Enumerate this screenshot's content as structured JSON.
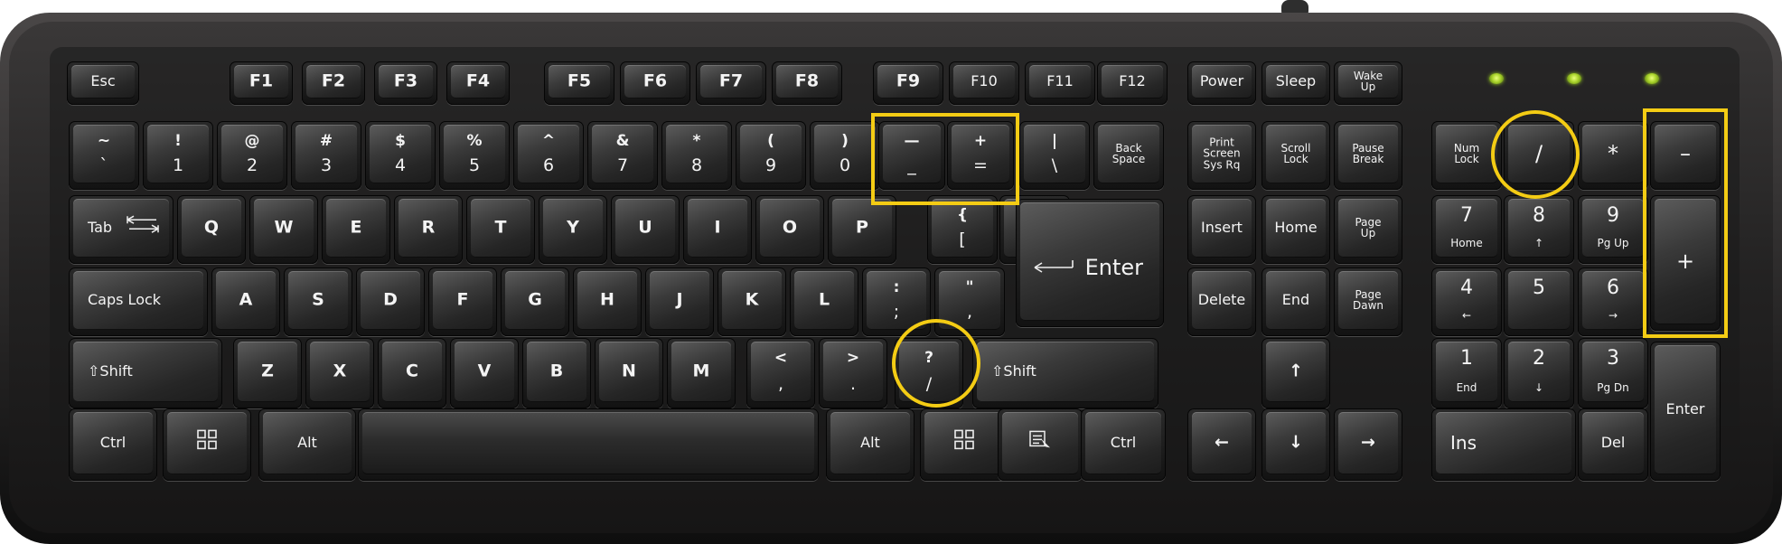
{
  "colors": {
    "body": "#1c1c1c",
    "highlight": "#f4cc14",
    "led": "#a8d22a",
    "legend": "#f4f4f4"
  },
  "indicator_leds": 3,
  "keys": [
    {
      "id": "esc",
      "name": "esc-key",
      "label": "Esc"
    },
    {
      "id": "f1",
      "name": "f1-key",
      "label": "F1"
    },
    {
      "id": "f2",
      "name": "f2-key",
      "label": "F2"
    },
    {
      "id": "f3",
      "name": "f3-key",
      "label": "F3"
    },
    {
      "id": "f4",
      "name": "f4-key",
      "label": "F4"
    },
    {
      "id": "f5",
      "name": "f5-key",
      "label": "F5"
    },
    {
      "id": "f6",
      "name": "f6-key",
      "label": "F6"
    },
    {
      "id": "f7",
      "name": "f7-key",
      "label": "F7"
    },
    {
      "id": "f8",
      "name": "f8-key",
      "label": "F8"
    },
    {
      "id": "f9",
      "name": "f9-key",
      "label": "F9"
    },
    {
      "id": "f10",
      "name": "f10-key",
      "label": "F10"
    },
    {
      "id": "f11",
      "name": "f11-key",
      "label": "F11"
    },
    {
      "id": "f12",
      "name": "f12-key",
      "label": "F12"
    },
    {
      "id": "power",
      "name": "power-key",
      "label": "Power"
    },
    {
      "id": "sleep",
      "name": "sleep-key",
      "label": "Sleep"
    },
    {
      "id": "wake",
      "name": "wake-up-key",
      "label": "Wake\nUp"
    },
    {
      "id": "tilde",
      "name": "tilde-key",
      "upper": "~",
      "lower": "`"
    },
    {
      "id": "d1",
      "name": "key-1",
      "upper": "!",
      "lower": "1"
    },
    {
      "id": "d2",
      "name": "key-2",
      "upper": "@",
      "lower": "2"
    },
    {
      "id": "d3",
      "name": "key-3",
      "upper": "#",
      "lower": "3"
    },
    {
      "id": "d4",
      "name": "key-4",
      "upper": "$",
      "lower": "4"
    },
    {
      "id": "d5",
      "name": "key-5",
      "upper": "%",
      "lower": "5"
    },
    {
      "id": "d6",
      "name": "key-6",
      "upper": "^",
      "lower": "6"
    },
    {
      "id": "d7",
      "name": "key-7",
      "upper": "&",
      "lower": "7"
    },
    {
      "id": "d8",
      "name": "key-8",
      "upper": "*",
      "lower": "8"
    },
    {
      "id": "d9",
      "name": "key-9",
      "upper": "(",
      "lower": "9"
    },
    {
      "id": "d0",
      "name": "key-0",
      "upper": ")",
      "lower": "0"
    },
    {
      "id": "minus",
      "name": "minus-key",
      "upper": "—",
      "lower": "_"
    },
    {
      "id": "equal",
      "name": "equals-key",
      "upper": "+",
      "lower": "="
    },
    {
      "id": "backslash",
      "name": "backslash-key",
      "upper": "|",
      "lower": "\\"
    },
    {
      "id": "backspace",
      "name": "backspace-key",
      "label": "Back\nSpace"
    },
    {
      "id": "prtsc",
      "name": "print-screen-key",
      "label": "Print\nScreen\nSys Rq"
    },
    {
      "id": "scroll",
      "name": "scroll-lock-key",
      "label": "Scroll\nLock"
    },
    {
      "id": "pause",
      "name": "pause-break-key",
      "label": "Pause\nBreak"
    },
    {
      "id": "numlock",
      "name": "num-lock-key",
      "label": "Num\nLock"
    },
    {
      "id": "kpslash",
      "name": "numpad-divide-key",
      "label": "/"
    },
    {
      "id": "kpstar",
      "name": "numpad-multiply-key",
      "label": "*"
    },
    {
      "id": "kpminus",
      "name": "numpad-minus-key",
      "label": "–"
    },
    {
      "id": "tab",
      "name": "tab-key",
      "label": "Tab"
    },
    {
      "id": "q",
      "name": "key-q",
      "label": "Q"
    },
    {
      "id": "w",
      "name": "key-w",
      "label": "W"
    },
    {
      "id": "e",
      "name": "key-e",
      "label": "E"
    },
    {
      "id": "r",
      "name": "key-r",
      "label": "R"
    },
    {
      "id": "t",
      "name": "key-t",
      "label": "T"
    },
    {
      "id": "y",
      "name": "key-y",
      "label": "Y"
    },
    {
      "id": "u",
      "name": "key-u",
      "label": "U"
    },
    {
      "id": "i",
      "name": "key-i",
      "label": "I"
    },
    {
      "id": "o",
      "name": "key-o",
      "label": "O"
    },
    {
      "id": "p",
      "name": "key-p",
      "label": "P"
    },
    {
      "id": "lbracket",
      "name": "left-bracket-key",
      "upper": "{",
      "lower": "["
    },
    {
      "id": "rbracket",
      "name": "right-bracket-key",
      "upper": "}",
      "lower": "]"
    },
    {
      "id": "enter",
      "name": "enter-key",
      "label": "Enter"
    },
    {
      "id": "insert",
      "name": "insert-key",
      "label": "Insert"
    },
    {
      "id": "home",
      "name": "home-key",
      "label": "Home"
    },
    {
      "id": "pgup",
      "name": "page-up-key",
      "label": "Page\nUp"
    },
    {
      "id": "kp7",
      "name": "numpad-7-key",
      "upper": "7",
      "lower": "Home"
    },
    {
      "id": "kp8",
      "name": "numpad-8-key",
      "upper": "8",
      "lower": "↑"
    },
    {
      "id": "kp9",
      "name": "numpad-9-key",
      "upper": "9",
      "lower": "Pg Up"
    },
    {
      "id": "kpplus",
      "name": "numpad-plus-key",
      "label": "+"
    },
    {
      "id": "caps",
      "name": "caps-lock-key",
      "label": "Caps Lock"
    },
    {
      "id": "a",
      "name": "key-a",
      "label": "A"
    },
    {
      "id": "s",
      "name": "key-s",
      "label": "S"
    },
    {
      "id": "d",
      "name": "key-d",
      "label": "D"
    },
    {
      "id": "f",
      "name": "key-f",
      "label": "F"
    },
    {
      "id": "g",
      "name": "key-g",
      "label": "G"
    },
    {
      "id": "h",
      "name": "key-h",
      "label": "H"
    },
    {
      "id": "j",
      "name": "key-j",
      "label": "J"
    },
    {
      "id": "k",
      "name": "key-k",
      "label": "K"
    },
    {
      "id": "l",
      "name": "key-l",
      "label": "L"
    },
    {
      "id": "semicolon",
      "name": "semicolon-key",
      "upper": ":",
      "lower": ";"
    },
    {
      "id": "quote",
      "name": "quote-key",
      "upper": "\"",
      "lower": ","
    },
    {
      "id": "delete",
      "name": "delete-key",
      "label": "Delete"
    },
    {
      "id": "end",
      "name": "end-key",
      "label": "End"
    },
    {
      "id": "pgdn",
      "name": "page-down-key",
      "label": "Page\nDawn"
    },
    {
      "id": "kp4",
      "name": "numpad-4-key",
      "upper": "4",
      "lower": "←"
    },
    {
      "id": "kp5",
      "name": "numpad-5-key",
      "upper": "5",
      "lower": ""
    },
    {
      "id": "kp6",
      "name": "numpad-6-key",
      "upper": "6",
      "lower": "→"
    },
    {
      "id": "lshift",
      "name": "left-shift-key",
      "label": "⇧Shift"
    },
    {
      "id": "z",
      "name": "key-z",
      "label": "Z"
    },
    {
      "id": "x",
      "name": "key-x",
      "label": "X"
    },
    {
      "id": "c",
      "name": "key-c",
      "label": "C"
    },
    {
      "id": "v",
      "name": "key-v",
      "label": "V"
    },
    {
      "id": "b",
      "name": "key-b",
      "label": "B"
    },
    {
      "id": "n",
      "name": "key-n",
      "label": "N"
    },
    {
      "id": "m",
      "name": "key-m",
      "label": "M"
    },
    {
      "id": "comma",
      "name": "comma-key",
      "upper": "<",
      "lower": ","
    },
    {
      "id": "period",
      "name": "period-key",
      "upper": ">",
      "lower": "."
    },
    {
      "id": "slash",
      "name": "slash-key",
      "upper": "?",
      "lower": "/"
    },
    {
      "id": "rshift",
      "name": "right-shift-key",
      "label": "⇧Shift"
    },
    {
      "id": "up",
      "name": "arrow-up-key",
      "label": "↑"
    },
    {
      "id": "kp1",
      "name": "numpad-1-key",
      "upper": "1",
      "lower": "End"
    },
    {
      "id": "kp2",
      "name": "numpad-2-key",
      "upper": "2",
      "lower": "↓"
    },
    {
      "id": "kp3",
      "name": "numpad-3-key",
      "upper": "3",
      "lower": "Pg Dn"
    },
    {
      "id": "kpenter",
      "name": "numpad-enter-key",
      "label": "Enter"
    },
    {
      "id": "lctrl",
      "name": "left-ctrl-key",
      "label": "Ctrl"
    },
    {
      "id": "lwin",
      "name": "left-windows-key",
      "label": ""
    },
    {
      "id": "lalt",
      "name": "left-alt-key",
      "label": "Alt"
    },
    {
      "id": "space",
      "name": "space-bar",
      "label": ""
    },
    {
      "id": "ralt",
      "name": "right-alt-key",
      "label": "Alt"
    },
    {
      "id": "rwin",
      "name": "right-windows-key",
      "label": ""
    },
    {
      "id": "menu",
      "name": "menu-key",
      "label": ""
    },
    {
      "id": "rctrl",
      "name": "right-ctrl-key",
      "label": "Ctrl"
    },
    {
      "id": "left",
      "name": "arrow-left-key",
      "label": "←"
    },
    {
      "id": "down",
      "name": "arrow-down-key",
      "label": "↓"
    },
    {
      "id": "right",
      "name": "arrow-right-key",
      "label": "→"
    },
    {
      "id": "ins",
      "name": "numpad-ins-key",
      "label": "Ins"
    },
    {
      "id": "del",
      "name": "numpad-del-key",
      "label": "Del"
    }
  ]
}
